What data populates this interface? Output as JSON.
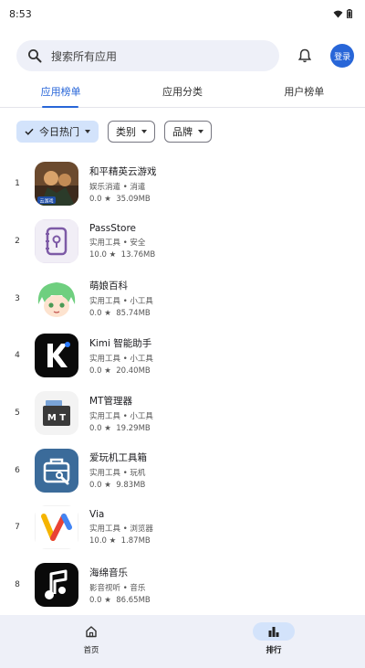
{
  "status": {
    "time": "8:53"
  },
  "search": {
    "placeholder": "搜索所有应用",
    "login_label": "登录"
  },
  "tabs": [
    {
      "label": "应用榜单",
      "active": true
    },
    {
      "label": "应用分类",
      "active": false
    },
    {
      "label": "用户榜单",
      "active": false
    }
  ],
  "filters": [
    {
      "label": "今日热门",
      "selected": true
    },
    {
      "label": "类别",
      "selected": false
    },
    {
      "label": "品牌",
      "selected": false
    }
  ],
  "apps": [
    {
      "rank": "1",
      "name": "和平精英云游戏",
      "category": "娱乐消遣 • 消遣",
      "rating": "0.0 ★",
      "size": "35.09MB",
      "icon": "peace-elite-cloud-game-icon"
    },
    {
      "rank": "2",
      "name": "PassStore",
      "category": "实用工具 • 安全",
      "rating": "10.0 ★",
      "size": "13.76MB",
      "icon": "passstore-icon"
    },
    {
      "rank": "3",
      "name": "萌娘百科",
      "category": "实用工具 • 小工具",
      "rating": "0.0 ★",
      "size": "85.74MB",
      "icon": "moegirl-icon"
    },
    {
      "rank": "4",
      "name": "Kimi 智能助手",
      "category": "实用工具 • 小工具",
      "rating": "0.0 ★",
      "size": "20.40MB",
      "icon": "kimi-icon"
    },
    {
      "rank": "5",
      "name": "MT管理器",
      "category": "实用工具 • 小工具",
      "rating": "0.0 ★",
      "size": "19.29MB",
      "icon": "mt-manager-icon"
    },
    {
      "rank": "6",
      "name": "爱玩机工具箱",
      "category": "实用工具 • 玩机",
      "rating": "0.0 ★",
      "size": "9.83MB",
      "icon": "toolbox-icon"
    },
    {
      "rank": "7",
      "name": "Via",
      "category": "实用工具 • 浏览器",
      "rating": "10.0 ★",
      "size": "1.87MB",
      "icon": "via-icon"
    },
    {
      "rank": "8",
      "name": "海绵音乐",
      "category": "影音视听 • 音乐",
      "rating": "0.0 ★",
      "size": "86.65MB",
      "icon": "sponge-music-icon"
    }
  ],
  "nav": [
    {
      "label": "首页",
      "icon": "home-icon",
      "active": false
    },
    {
      "label": "排行",
      "icon": "ranking-icon",
      "active": true
    }
  ],
  "colors": {
    "accent": "#2866d8",
    "chip_selected": "#d3e3fb",
    "nav_bg": "#eef0f8"
  }
}
